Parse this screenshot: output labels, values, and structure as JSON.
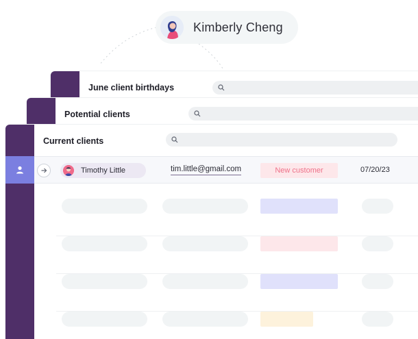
{
  "user": {
    "name": "Kimberly Cheng"
  },
  "lists": [
    {
      "title": "June client birthdays"
    },
    {
      "title": "Potential clients"
    },
    {
      "title": "Current clients"
    }
  ],
  "client_row": {
    "name": "Timothy Little",
    "email": "tim.little@gmail.com",
    "status": "New customer",
    "date": "07/20/23"
  },
  "colors": {
    "sidebar": "#4f2f68",
    "active_nav": "#7b7fe0",
    "status_bg": "#fde7ea",
    "status_text": "#ee7189",
    "placeholder_badges": [
      "#e0e1fb",
      "#fde7ea",
      "#e0e1fb",
      "#fdf2dc"
    ]
  },
  "icons": {
    "search": "search-icon",
    "person": "person-icon",
    "arrow": "arrow-right-icon"
  }
}
